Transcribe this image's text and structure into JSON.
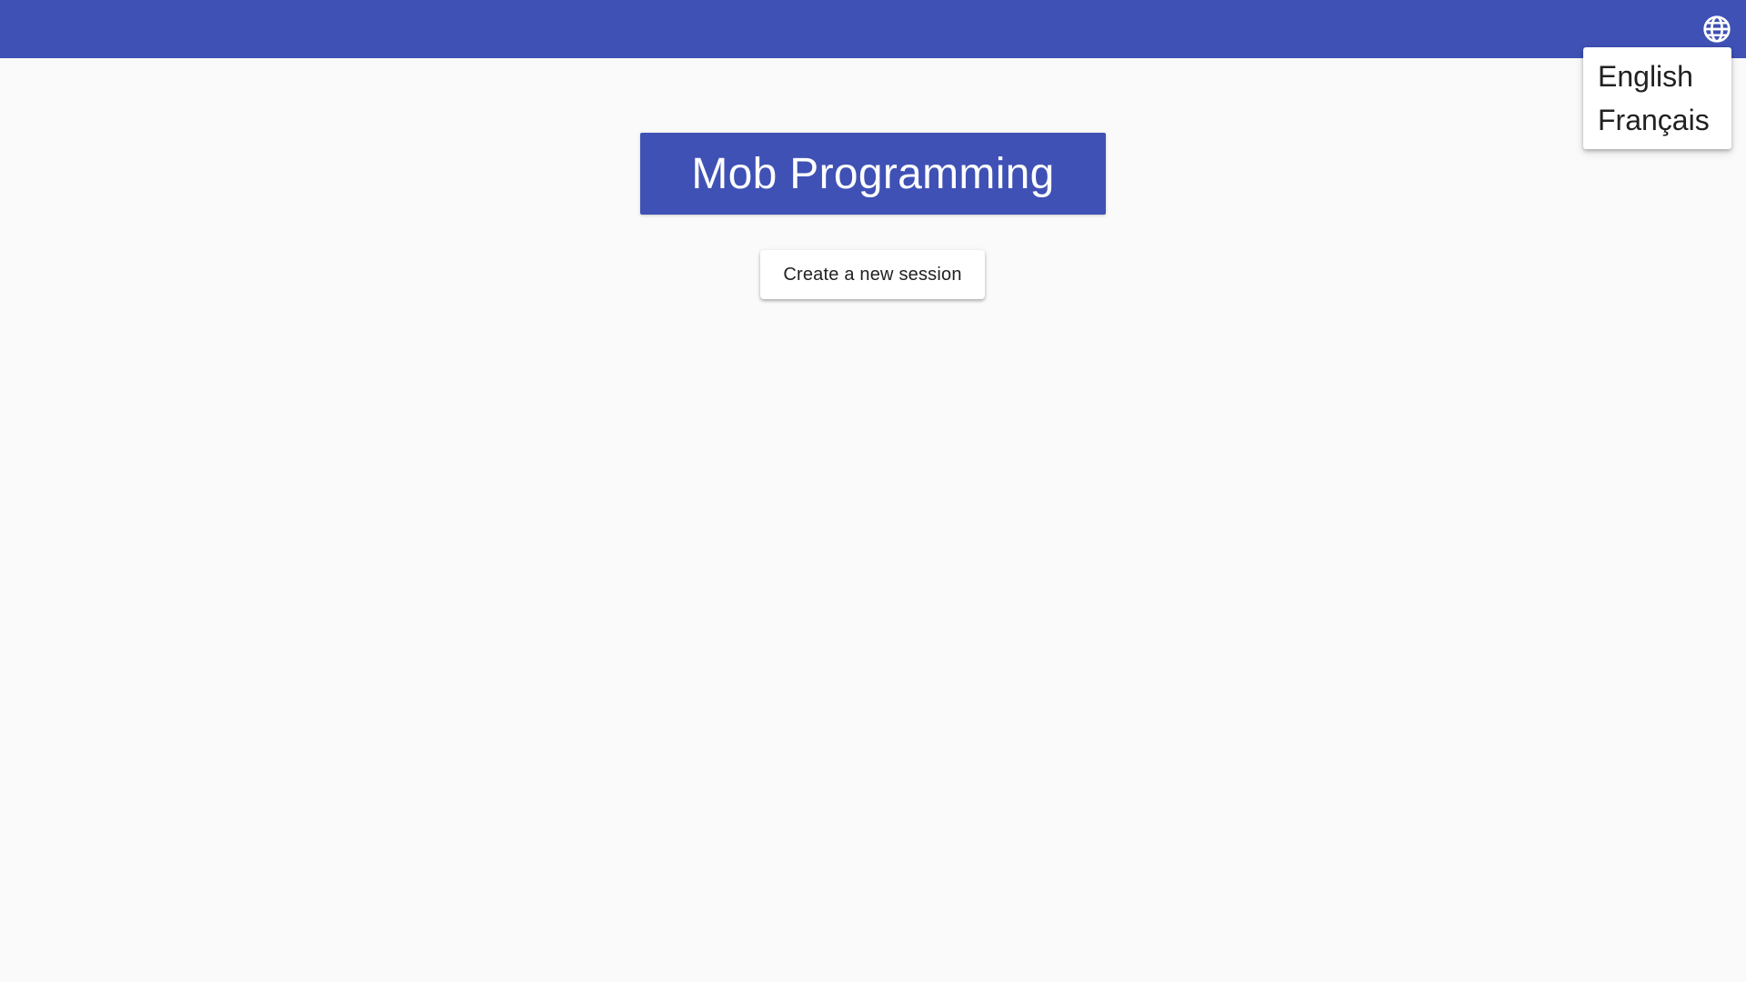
{
  "header": {
    "language_icon": "globe-icon",
    "background_color": "#3f51b5"
  },
  "language_menu": {
    "items": [
      {
        "label": "English"
      },
      {
        "label": "Français"
      }
    ]
  },
  "main": {
    "title": "Mob Programming",
    "title_background": "#3f51b5",
    "create_session_label": "Create a new session"
  }
}
